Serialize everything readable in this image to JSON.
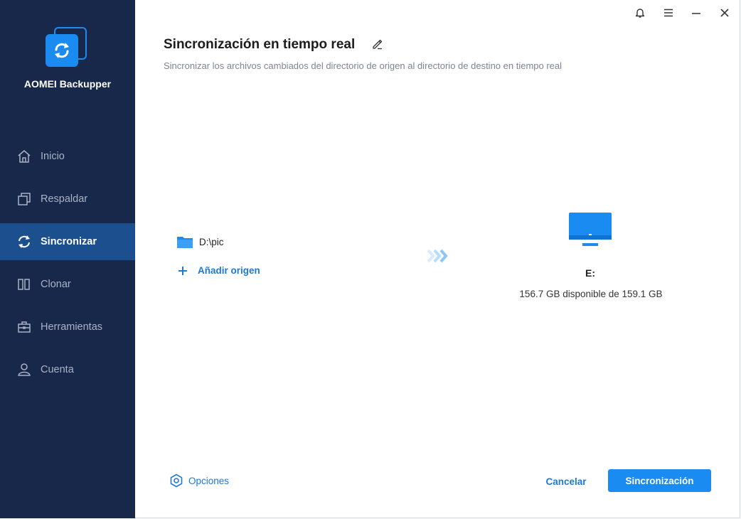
{
  "app": {
    "brand": "AOMEI Backupper"
  },
  "sidebar": {
    "items": [
      {
        "label": "Inicio",
        "icon": "home-icon"
      },
      {
        "label": "Respaldar",
        "icon": "backup-icon"
      },
      {
        "label": "Sincronizar",
        "icon": "sync-icon",
        "active": true
      },
      {
        "label": "Clonar",
        "icon": "clone-icon"
      },
      {
        "label": "Herramientas",
        "icon": "toolbox-icon"
      },
      {
        "label": "Cuenta",
        "icon": "user-icon"
      }
    ]
  },
  "titlebar": {
    "icons": [
      "bell-icon",
      "menu-icon",
      "minimize-icon",
      "close-icon"
    ]
  },
  "main": {
    "title": "Sincronización en tiempo real",
    "subtitle": "Sincronizar los archivos cambiados del directorio de origen al directorio de destino en tiempo real",
    "source": {
      "path": "D:\\pic",
      "add_label": "Añadir origen"
    },
    "destination": {
      "drive": "E:",
      "space": "156.7 GB disponible de 159.1 GB"
    }
  },
  "footer": {
    "options_label": "Opciones",
    "cancel_label": "Cancelar",
    "primary_label": "Sincronización"
  },
  "colors": {
    "sidebar_bg": "#18284a",
    "sidebar_active": "#1b4f8e",
    "accent": "#1a8cf1",
    "link": "#1f78d1"
  }
}
